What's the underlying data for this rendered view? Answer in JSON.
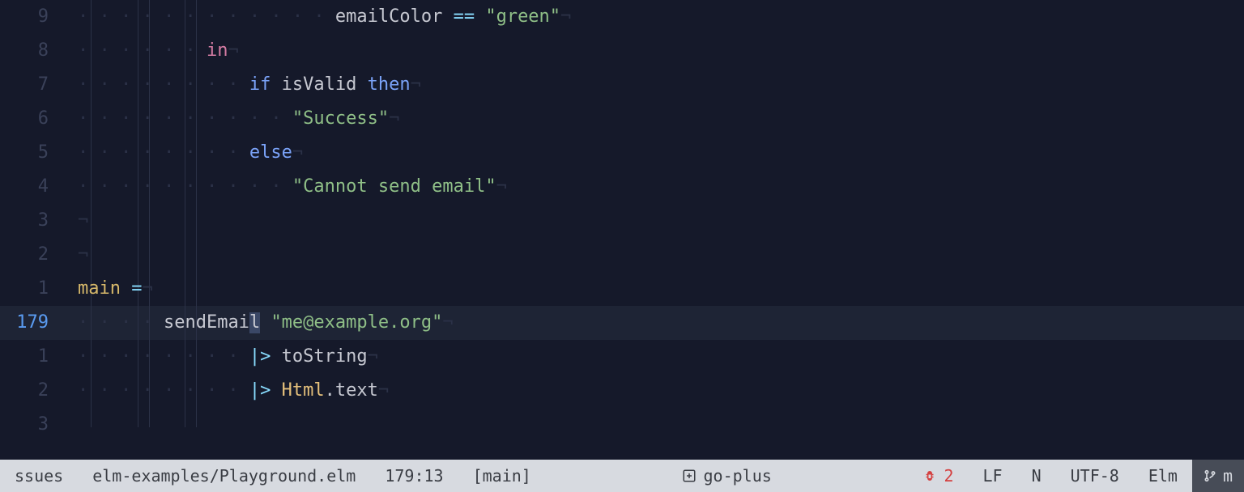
{
  "gutter": {
    "numbers": [
      "9",
      "8",
      "7",
      "6",
      "5",
      "4",
      "3",
      "2",
      "1",
      "179",
      "1",
      "2",
      "3"
    ],
    "active_index": 9
  },
  "code": {
    "l0": {
      "indent": 12,
      "id": "emailColor",
      "op": " == ",
      "str": "\"green\""
    },
    "l1": {
      "indent": 6,
      "kw": "in"
    },
    "l2": {
      "indent": 8,
      "kw2a": "if",
      "id": " isValid ",
      "kw2b": "then"
    },
    "l3": {
      "indent": 10,
      "str": "\"Success\""
    },
    "l4": {
      "indent": 8,
      "kw2": "else"
    },
    "l5": {
      "indent": 10,
      "str": "\"Cannot send email\""
    },
    "l6": {
      "indent": 0
    },
    "l7": {
      "indent": 0
    },
    "l8": {
      "indent": 0,
      "def": "main",
      "eq": " ="
    },
    "l9": {
      "indent": 4,
      "fn_pre": "sendEmai",
      "fn_sel": "l",
      "sp": " ",
      "str": "\"me@example.org\""
    },
    "l10": {
      "indent": 8,
      "op": "|>",
      "sp": " ",
      "id": "toString"
    },
    "l11": {
      "indent": 8,
      "op": "|>",
      "sp": " ",
      "type": "Html",
      "dot": ".",
      "id": "text"
    },
    "l12": {
      "indent": 0
    }
  },
  "eol_glyph": "¬",
  "statusbar": {
    "issues": "ssues",
    "filepath": "elm-examples/Playground.elm",
    "cursor": "179:13",
    "branch": "[main]",
    "goplus": "go-plus",
    "bug_count": "2",
    "line_ending": "LF",
    "mode": "N",
    "encoding": "UTF-8",
    "language": "Elm",
    "git_right_letter": "m"
  }
}
